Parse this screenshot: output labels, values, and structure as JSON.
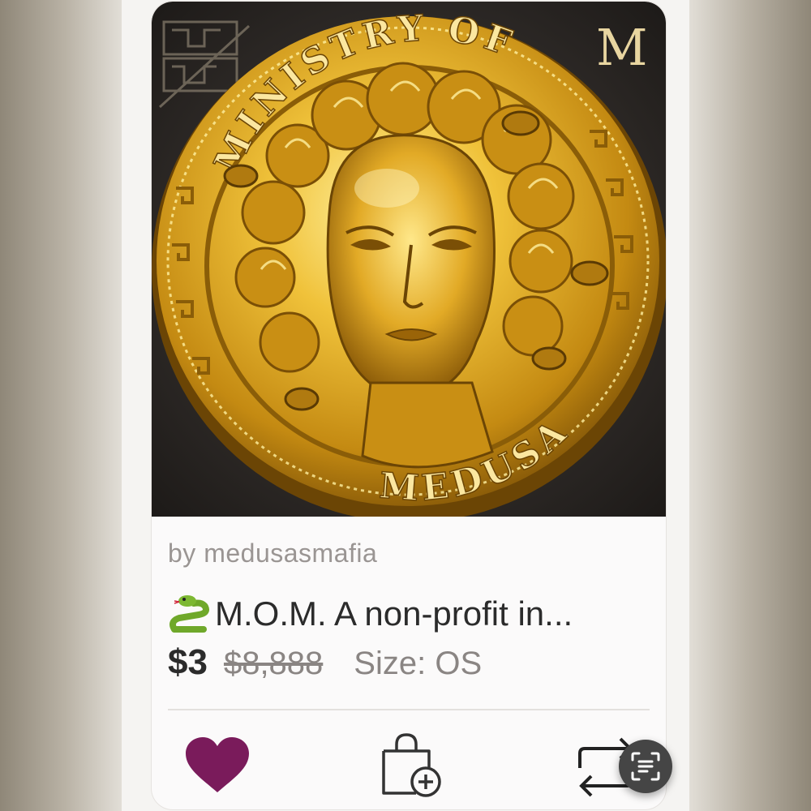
{
  "listing": {
    "image_alt": "Gold coin with Medusa head, lettering MINISTRY OF MEDUSA",
    "coin_text_top": "MINISTRY OF",
    "coin_text_bottom": "MEDUSA",
    "coin_corner_letter": "M",
    "seller": "by medusasmafia",
    "title_emoji": "snake",
    "title": "M.O.M. A non-profit in...",
    "price": "$3",
    "original_price": "$8,888",
    "size": "Size: OS"
  },
  "actions": {
    "like_icon": "heart-icon",
    "bundle_icon": "bag-plus-icon",
    "share_icon": "repost-icon",
    "scan_icon": "scan-text-icon"
  },
  "colors": {
    "like": "#7a1b5b",
    "text": "#2b2b2b",
    "muted": "#9a9593",
    "gold": "#d4a52a"
  }
}
